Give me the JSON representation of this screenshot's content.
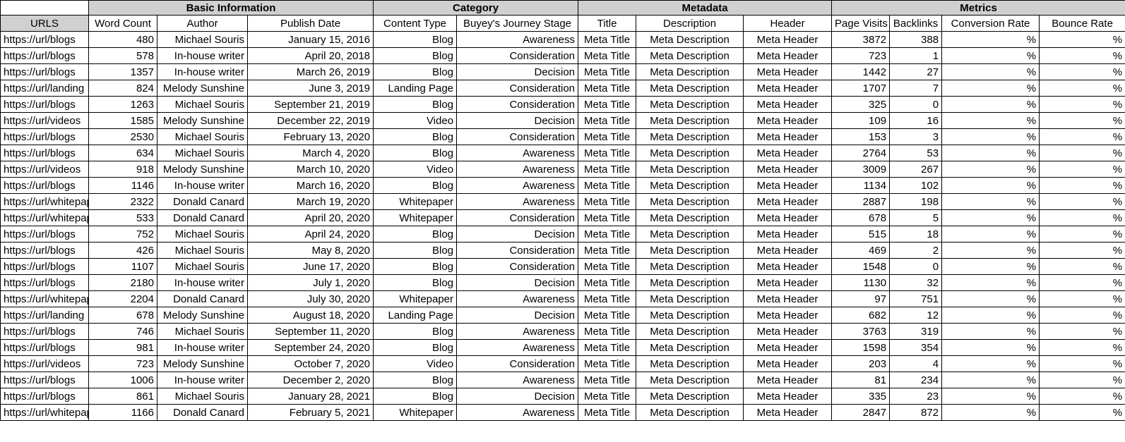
{
  "groups": [
    {
      "label": "",
      "span": 1,
      "blank": true
    },
    {
      "label": "Basic Information",
      "span": 3,
      "blank": false
    },
    {
      "label": "Category",
      "span": 2,
      "blank": false
    },
    {
      "label": "Metadata",
      "span": 3,
      "blank": false
    },
    {
      "label": "Metrics",
      "span": 4,
      "blank": false
    }
  ],
  "columns": [
    "URLS",
    "Word Count",
    "Author",
    "Publish Date",
    "Content Type",
    "Buyey's Journey Stage",
    "Title",
    "Description",
    "Header",
    "Page Visits",
    "Backlinks",
    "Conversion Rate",
    "Bounce Rate"
  ],
  "rows": [
    [
      "https://url/blogs",
      "480",
      "Michael Souris",
      "January 15, 2016",
      "Blog",
      "Awareness",
      "Meta Title",
      "Meta Description",
      "Meta Header",
      "3872",
      "388",
      "%",
      "%"
    ],
    [
      "https://url/blogs",
      "578",
      "In-house writer",
      "April 20, 2018",
      "Blog",
      "Consideration",
      "Meta Title",
      "Meta Description",
      "Meta Header",
      "723",
      "1",
      "%",
      "%"
    ],
    [
      "https://url/blogs",
      "1357",
      "In-house writer",
      "March 26, 2019",
      "Blog",
      "Decision",
      "Meta Title",
      "Meta Description",
      "Meta Header",
      "1442",
      "27",
      "%",
      "%"
    ],
    [
      "https://url/landing",
      "824",
      "Melody Sunshine",
      "June 3, 2019",
      "Landing Page",
      "Consideration",
      "Meta Title",
      "Meta Description",
      "Meta Header",
      "1707",
      "7",
      "%",
      "%"
    ],
    [
      "https://url/blogs",
      "1263",
      "Michael Souris",
      "September 21, 2019",
      "Blog",
      "Consideration",
      "Meta Title",
      "Meta Description",
      "Meta Header",
      "325",
      "0",
      "%",
      "%"
    ],
    [
      "https://url/videos",
      "1585",
      "Melody Sunshine",
      "December 22, 2019",
      "Video",
      "Decision",
      "Meta Title",
      "Meta Description",
      "Meta Header",
      "109",
      "16",
      "%",
      "%"
    ],
    [
      "https://url/blogs",
      "2530",
      "Michael Souris",
      "February 13, 2020",
      "Blog",
      "Consideration",
      "Meta Title",
      "Meta Description",
      "Meta Header",
      "153",
      "3",
      "%",
      "%"
    ],
    [
      "https://url/blogs",
      "634",
      "Michael Souris",
      "March 4, 2020",
      "Blog",
      "Awareness",
      "Meta Title",
      "Meta Description",
      "Meta Header",
      "2764",
      "53",
      "%",
      "%"
    ],
    [
      "https://url/videos",
      "918",
      "Melody Sunshine",
      "March 10, 2020",
      "Video",
      "Awareness",
      "Meta Title",
      "Meta Description",
      "Meta Header",
      "3009",
      "267",
      "%",
      "%"
    ],
    [
      "https://url/blogs",
      "1146",
      "In-house writer",
      "March 16, 2020",
      "Blog",
      "Awareness",
      "Meta Title",
      "Meta Description",
      "Meta Header",
      "1134",
      "102",
      "%",
      "%"
    ],
    [
      "https://url/whitepaper",
      "2322",
      "Donald Canard",
      "March 19, 2020",
      "Whitepaper",
      "Awareness",
      "Meta Title",
      "Meta Description",
      "Meta Header",
      "2887",
      "198",
      "%",
      "%"
    ],
    [
      "https://url/whitepaper",
      "533",
      "Donald Canard",
      "April 20, 2020",
      "Whitepaper",
      "Consideration",
      "Meta Title",
      "Meta Description",
      "Meta Header",
      "678",
      "5",
      "%",
      "%"
    ],
    [
      "https://url/blogs",
      "752",
      "Michael Souris",
      "April 24, 2020",
      "Blog",
      "Decision",
      "Meta Title",
      "Meta Description",
      "Meta Header",
      "515",
      "18",
      "%",
      "%"
    ],
    [
      "https://url/blogs",
      "426",
      "Michael Souris",
      "May 8, 2020",
      "Blog",
      "Consideration",
      "Meta Title",
      "Meta Description",
      "Meta Header",
      "469",
      "2",
      "%",
      "%"
    ],
    [
      "https://url/blogs",
      "1107",
      "Michael Souris",
      "June 17, 2020",
      "Blog",
      "Consideration",
      "Meta Title",
      "Meta Description",
      "Meta Header",
      "1548",
      "0",
      "%",
      "%"
    ],
    [
      "https://url/blogs",
      "2180",
      "In-house writer",
      "July 1, 2020",
      "Blog",
      "Decision",
      "Meta Title",
      "Meta Description",
      "Meta Header",
      "1130",
      "32",
      "%",
      "%"
    ],
    [
      "https://url/whitepaper",
      "2204",
      "Donald Canard",
      "July 30, 2020",
      "Whitepaper",
      "Awareness",
      "Meta Title",
      "Meta Description",
      "Meta Header",
      "97",
      "751",
      "%",
      "%"
    ],
    [
      "https://url/landing",
      "678",
      "Melody Sunshine",
      "August 18, 2020",
      "Landing Page",
      "Decision",
      "Meta Title",
      "Meta Description",
      "Meta Header",
      "682",
      "12",
      "%",
      "%"
    ],
    [
      "https://url/blogs",
      "746",
      "Michael Souris",
      "September 11, 2020",
      "Blog",
      "Awareness",
      "Meta Title",
      "Meta Description",
      "Meta Header",
      "3763",
      "319",
      "%",
      "%"
    ],
    [
      "https://url/blogs",
      "981",
      "In-house writer",
      "September 24, 2020",
      "Blog",
      "Awareness",
      "Meta Title",
      "Meta Description",
      "Meta Header",
      "1598",
      "354",
      "%",
      "%"
    ],
    [
      "https://url/videos",
      "723",
      "Melody Sunshine",
      "October 7, 2020",
      "Video",
      "Consideration",
      "Meta Title",
      "Meta Description",
      "Meta Header",
      "203",
      "4",
      "%",
      "%"
    ],
    [
      "https://url/blogs",
      "1006",
      "In-house writer",
      "December 2, 2020",
      "Blog",
      "Awareness",
      "Meta Title",
      "Meta Description",
      "Meta Header",
      "81",
      "234",
      "%",
      "%"
    ],
    [
      "https://url/blogs",
      "861",
      "Michael Souris",
      "January 28, 2021",
      "Blog",
      "Decision",
      "Meta Title",
      "Meta Description",
      "Meta Header",
      "335",
      "23",
      "%",
      "%"
    ],
    [
      "https://url/whitepaper",
      "1166",
      "Donald Canard",
      "February 5, 2021",
      "Whitepaper",
      "Awareness",
      "Meta Title",
      "Meta Description",
      "Meta Header",
      "2847",
      "872",
      "%",
      "%"
    ]
  ],
  "colors": {
    "header_fill": "#d0d0d0",
    "grid_line": "#000000",
    "text": "#000000",
    "background": "#ffffff"
  }
}
